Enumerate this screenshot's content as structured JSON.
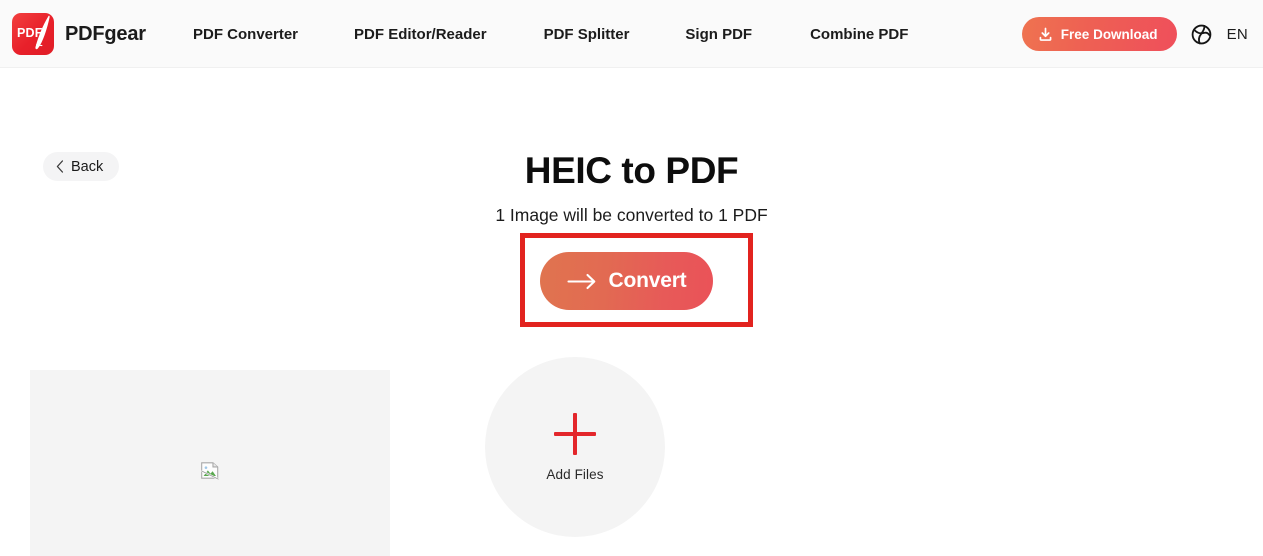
{
  "header": {
    "logo": {
      "icon_name": "pdfgear-logo-icon",
      "badge_text": "PDF",
      "brand_name": "PDFgear"
    },
    "nav": [
      {
        "label": "PDF Converter"
      },
      {
        "label": "PDF Editor/Reader"
      },
      {
        "label": "PDF Splitter"
      },
      {
        "label": "Sign PDF"
      },
      {
        "label": "Combine PDF"
      }
    ],
    "download_button": {
      "label": "Free Download",
      "icon_name": "download-icon",
      "gradient_from": "#ef7350",
      "gradient_to": "#ef4f5b"
    },
    "language": {
      "icon_name": "globe-icon",
      "label": "EN"
    },
    "background": "#fafafa"
  },
  "main": {
    "back_button": {
      "label": "Back",
      "icon_name": "chevron-left-icon"
    },
    "page_title": "HEIC to PDF",
    "subtitle": "1 Image will be converted to 1 PDF",
    "convert_button": {
      "label": "Convert",
      "icon_name": "arrow-right-icon",
      "gradient_from": "#e0744f",
      "gradient_to": "#ea5258"
    },
    "highlight": {
      "name": "convert-button-highlight",
      "color": "#e2231f"
    },
    "thumbnail": {
      "icon_name": "broken-image-icon",
      "background": "#f4f4f4"
    },
    "add_files": {
      "label": "Add Files",
      "icon_name": "plus-icon",
      "icon_color": "#e3262b",
      "background": "#f4f4f4"
    }
  }
}
